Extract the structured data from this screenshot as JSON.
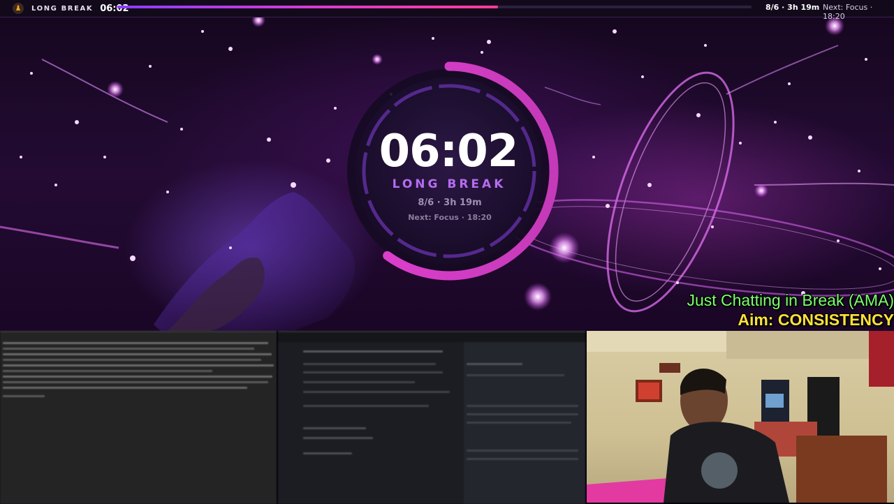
{
  "topbar": {
    "mode_label": "LONG BREAK",
    "time": "06:02",
    "progress": 0.6,
    "date_stat": "8/6 · 3h 19m",
    "next_stat": "Next: Focus · 18:20",
    "logo_icon": "meditation-icon"
  },
  "timer": {
    "time": "06:02",
    "mode_label": "LONG BREAK",
    "date_line": "8/6 · 3h 19m",
    "next_line": "Next: Focus · 18:20",
    "ring_progress": 0.6,
    "accent": "#e03fd0"
  },
  "overlay": {
    "title": "Just Chatting in Break (AMA)",
    "aim": "Aim: CONSISTENCY"
  },
  "colors": {
    "progress_start": "#8a3cff",
    "progress_end": "#ff3c9a",
    "title_text": "#7dff6e",
    "aim_text": "#ffe23a"
  }
}
